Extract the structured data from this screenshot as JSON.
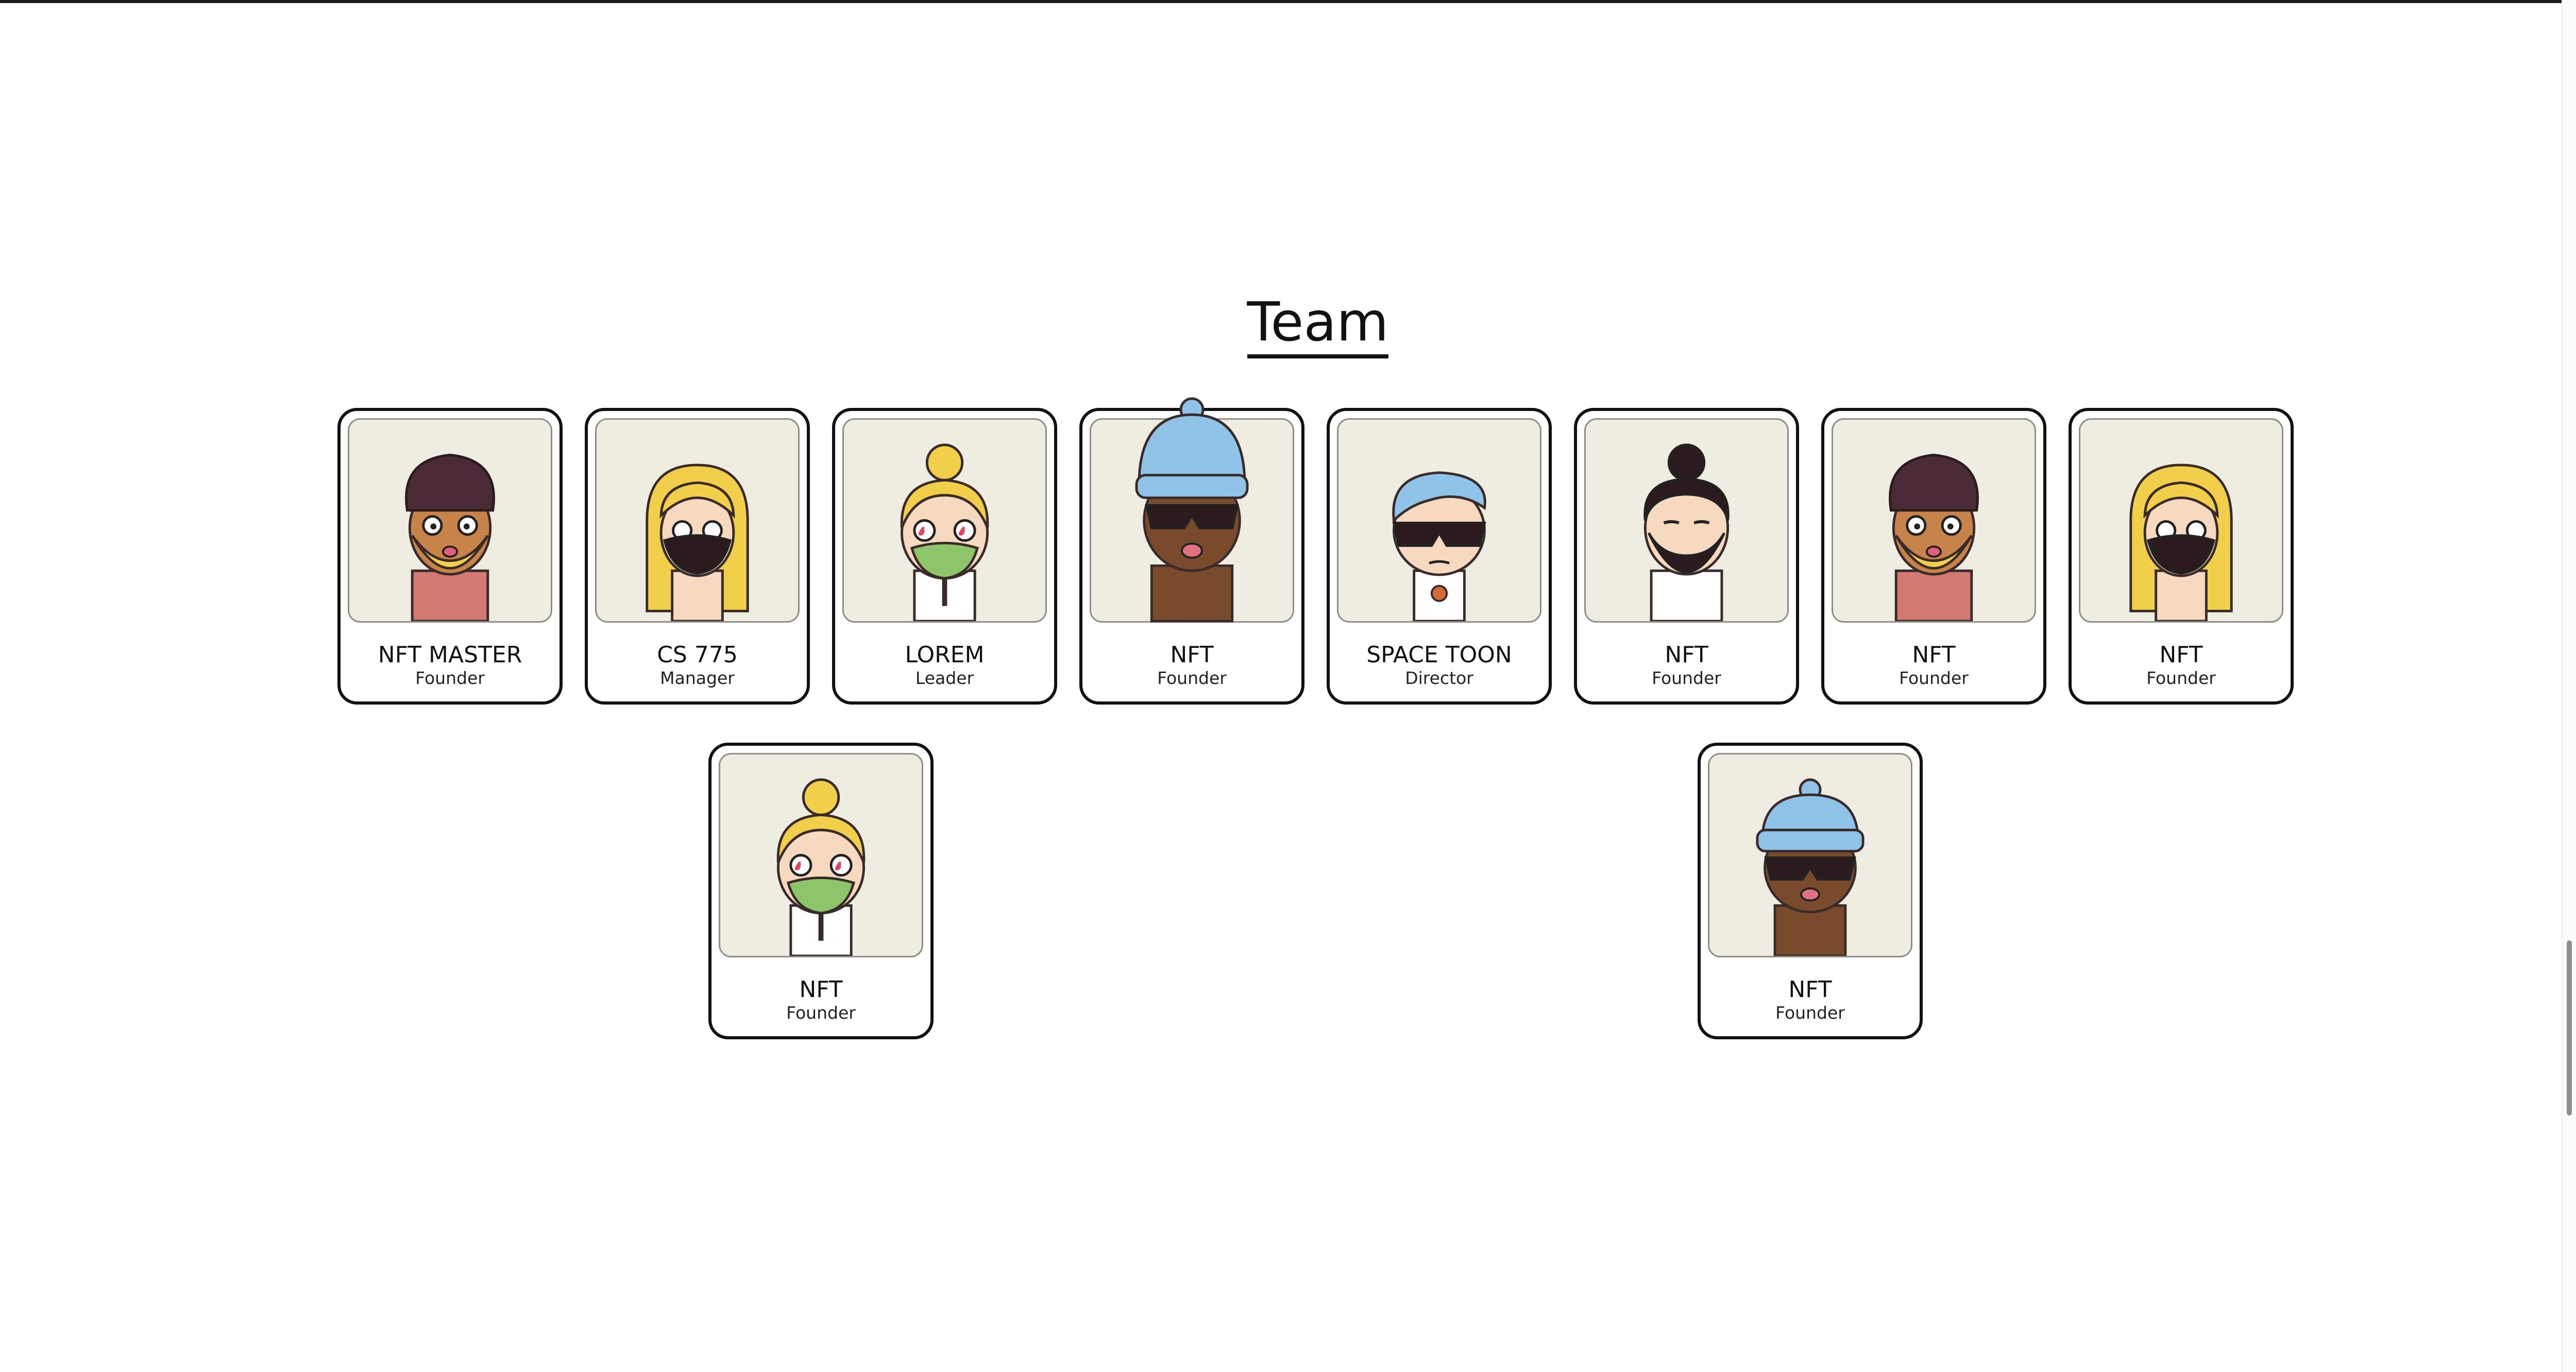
{
  "section": {
    "title": "Team"
  },
  "members": [
    {
      "name": "NFT MASTER",
      "role": "Founder",
      "avatar": "turban-bearded-avatar"
    },
    {
      "name": "CS 775",
      "role": "Manager",
      "avatar": "blonde-masked-avatar"
    },
    {
      "name": "LOREM",
      "role": "Leader",
      "avatar": "bun-masked-avatar"
    },
    {
      "name": "NFT",
      "role": "Founder",
      "avatar": "beanie-sunglasses-avatar"
    },
    {
      "name": "SPACE TOON",
      "role": "Director",
      "avatar": "blue-hair-sunglasses-avatar"
    },
    {
      "name": "NFT",
      "role": "Founder",
      "avatar": "man-bun-bearded-avatar"
    },
    {
      "name": "NFT",
      "role": "Founder",
      "avatar": "turban-bearded-avatar"
    },
    {
      "name": "NFT",
      "role": "Founder",
      "avatar": "blonde-masked-avatar"
    },
    {
      "name": "NFT",
      "role": "Founder",
      "avatar": "bun-masked-avatar"
    },
    {
      "name": "NFT",
      "role": "Founder",
      "avatar": "beanie-sunglasses-avatar"
    }
  ],
  "colors": {
    "card_border": "#111111",
    "avatar_background": "#efede2",
    "skin_dark": "#7a4a2c",
    "skin_tan": "#c8834a",
    "skin_light": "#f6d9bf",
    "hair_blonde": "#f2cf4a",
    "turban": "#4a2a36",
    "beanie": "#8fc3e8",
    "mask_green": "#8dc66a",
    "beard_dark": "#2b1b1e"
  }
}
